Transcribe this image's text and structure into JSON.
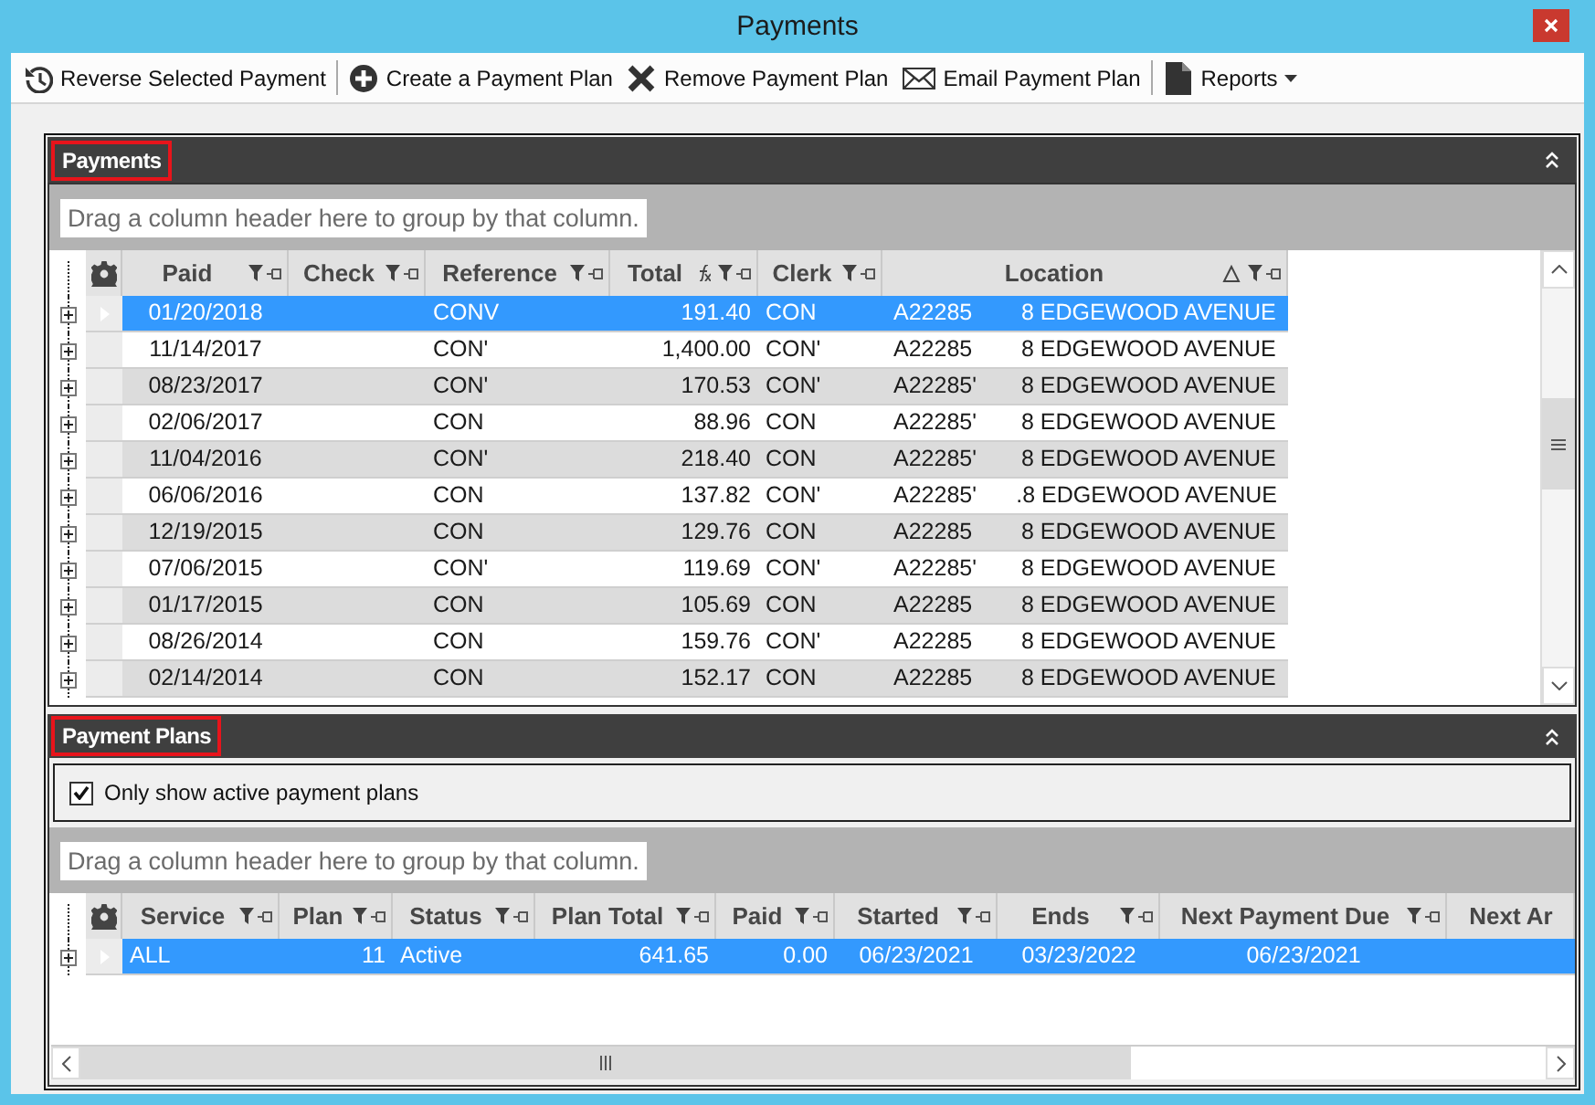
{
  "window": {
    "title": "Payments"
  },
  "toolbar": [
    {
      "label": "Reverse Selected Payment",
      "separator_after": true
    },
    {
      "label": "Create a Payment Plan",
      "separator_after": false
    },
    {
      "label": "Remove Payment Plan",
      "separator_after": false
    },
    {
      "label": "Email Payment Plan",
      "separator_after": true
    },
    {
      "label": "Reports",
      "separator_after": false,
      "dropdown": true
    }
  ],
  "payments": {
    "title": "Payments",
    "group_hint": "Drag a column header here to group by that column.",
    "columns": [
      {
        "label": "Paid",
        "filter": true
      },
      {
        "label": "Check",
        "filter": true
      },
      {
        "label": "Reference",
        "filter": true
      },
      {
        "label": "Total",
        "filter": true,
        "formula": true
      },
      {
        "label": "Clerk",
        "filter": true
      },
      {
        "label": "Location",
        "filter": true,
        "sorted_ascending": true
      }
    ],
    "rows": [
      {
        "paid": "01/20/2018",
        "reference": "CONV",
        "total": "191.40",
        "clerk": "CON",
        "location_code": "A22285",
        "location": "8 EDGEWOOD AVENUE",
        "selected": true
      },
      {
        "paid": "11/14/2017",
        "reference": "CON'",
        "total": "1,400.00",
        "clerk": "CON'",
        "location_code": "A22285",
        "location": "8 EDGEWOOD AVENUE",
        "selected": false
      },
      {
        "paid": "08/23/2017",
        "reference": "CON'",
        "total": "170.53",
        "clerk": "CON'",
        "location_code": "A22285'",
        "location": "8 EDGEWOOD AVENUE",
        "selected": false
      },
      {
        "paid": "02/06/2017",
        "reference": "CON",
        "total": "88.96",
        "clerk": "CON",
        "location_code": "A22285'",
        "location": "8 EDGEWOOD AVENUE",
        "selected": false
      },
      {
        "paid": "11/04/2016",
        "reference": "CON'",
        "total": "218.40",
        "clerk": "CON",
        "location_code": "A22285'",
        "location": "8 EDGEWOOD AVENUE",
        "selected": false
      },
      {
        "paid": "06/06/2016",
        "reference": "CON",
        "total": "137.82",
        "clerk": "CON'",
        "location_code": "A22285'",
        "location": ".8 EDGEWOOD AVENUE",
        "selected": false
      },
      {
        "paid": "12/19/2015",
        "reference": "CON",
        "total": "129.76",
        "clerk": "CON",
        "location_code": "A22285",
        "location": "8 EDGEWOOD AVENUE",
        "selected": false
      },
      {
        "paid": "07/06/2015",
        "reference": "CON'",
        "total": "119.69",
        "clerk": "CON'",
        "location_code": "A22285'",
        "location": "8 EDGEWOOD AVENUE",
        "selected": false
      },
      {
        "paid": "01/17/2015",
        "reference": "CON",
        "total": "105.69",
        "clerk": "CON",
        "location_code": "A22285",
        "location": "8 EDGEWOOD AVENUE",
        "selected": false
      },
      {
        "paid": "08/26/2014",
        "reference": "CON",
        "total": "159.76",
        "clerk": "CON'",
        "location_code": "A22285",
        "location": "8 EDGEWOOD AVENUE",
        "selected": false
      },
      {
        "paid": "02/14/2014",
        "reference": "CON",
        "total": "152.17",
        "clerk": "CON",
        "location_code": "A22285",
        "location": "8 EDGEWOOD AVENUE",
        "selected": false
      }
    ]
  },
  "payment_plans": {
    "title": "Payment Plans",
    "filter_checkbox": {
      "label": "Only show active payment plans",
      "checked": true
    },
    "group_hint": "Drag a column header here to group by that column.",
    "columns": [
      {
        "label": "Service",
        "filter": true
      },
      {
        "label": "Plan",
        "filter": true
      },
      {
        "label": "Status",
        "filter": true
      },
      {
        "label": "Plan Total",
        "filter": true
      },
      {
        "label": "Paid",
        "filter": true
      },
      {
        "label": "Started",
        "filter": true
      },
      {
        "label": "Ends",
        "filter": true
      },
      {
        "label": "Next Payment Due",
        "filter": true
      },
      {
        "label": "Next Ar",
        "filter": false
      }
    ],
    "rows": [
      {
        "service": "ALL",
        "plan": "11",
        "status": "Active",
        "plan_total": "641.65",
        "paid": "0.00",
        "started": "06/23/2021",
        "ends": "03/23/2022",
        "next_payment_due": "06/23/2021",
        "selected": true
      }
    ]
  }
}
